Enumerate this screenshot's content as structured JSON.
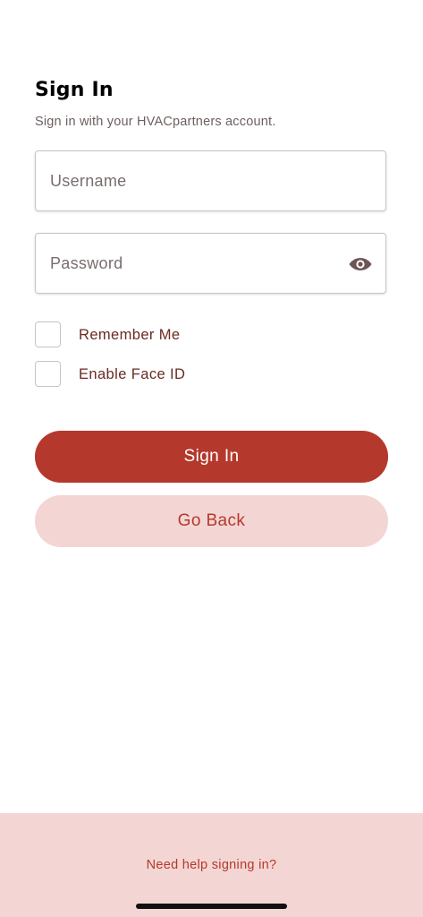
{
  "header": {
    "title": "Sign In",
    "subtitle": "Sign in with your HVACpartners account."
  },
  "form": {
    "username_placeholder": "Username",
    "password_placeholder": "Password",
    "password_toggle_icon": "eye-icon",
    "remember_me_label": "Remember Me",
    "remember_me_checked": false,
    "face_id_label": "Enable Face ID",
    "face_id_checked": false
  },
  "actions": {
    "sign_in_label": "Sign In",
    "go_back_label": "Go Back"
  },
  "footer": {
    "help_label": "Need help signing in?"
  },
  "colors": {
    "primary": "#b5382c",
    "primary_light": "#f3d6d3",
    "label_text": "#6b2a22"
  }
}
